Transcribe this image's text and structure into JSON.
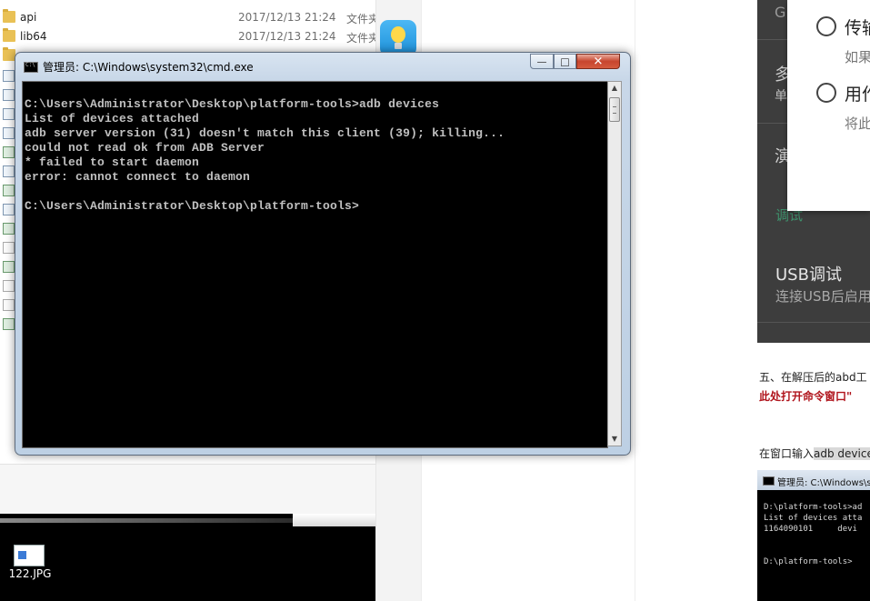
{
  "explorer": {
    "rows": [
      {
        "name": "api",
        "date": "2017/12/13 21:24",
        "type": "文件夹"
      },
      {
        "name": "lib64",
        "date": "2017/12/13 21:24",
        "type": "文件夹"
      }
    ]
  },
  "desktop": {
    "file_label": "122.JPG"
  },
  "cmd": {
    "title": "管理员: C:\\Windows\\system32\\cmd.exe",
    "min_glyph": "—",
    "max_glyph": "□",
    "close_glyph": "✕",
    "lines": [
      "C:\\Users\\Administrator\\Desktop\\platform-tools>adb devices",
      "List of devices attached",
      "adb server version (31) doesn't match this client (39); killing...",
      "could not read ok from ADB Server",
      "* failed to start daemon",
      "error: cannot connect to daemon",
      "",
      "C:\\Users\\Administrator\\Desktop\\platform-tools>"
    ],
    "scroll_up": "▲",
    "scroll_down": "▼"
  },
  "phone": {
    "opt1_title": "传输",
    "opt1_sub": "如果",
    "opt2_title": "用作",
    "opt2_sub": "将此",
    "side_g": "G",
    "side_duo": "多",
    "side_dan": "单",
    "side_yan": "演",
    "debug_section": "调试",
    "usb_title": "USB调试",
    "usb_sub": "连接USB后启用"
  },
  "article": {
    "p1": "五、在解压后的abd工",
    "p2": "此处打开命令窗口\"",
    "p3_prefix": "在窗口输入",
    "p3_highlight": "adb device"
  },
  "cmd_thumb": {
    "title": "管理员: C:\\Windows\\sys",
    "lines": [
      "D:\\platform-tools>ad",
      "List of devices atta",
      "1164090101     devi",
      "",
      "",
      "D:\\platform-tools>"
    ]
  },
  "colors": {
    "console_bg": "#000000",
    "console_text": "#c0c0c0",
    "article_red": "#b0141c",
    "debug_green": "#3e8f6b"
  }
}
